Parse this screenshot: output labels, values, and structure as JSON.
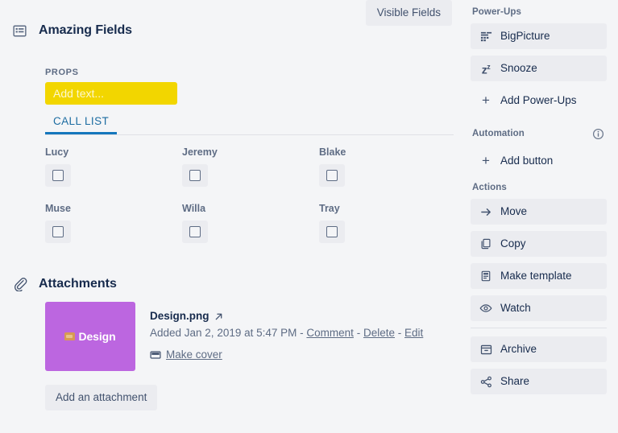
{
  "main": {
    "header": {
      "icon": "list-view-icon",
      "title": "Amazing Fields",
      "visible_fields_label": "Visible Fields"
    },
    "props": {
      "label": "PROPS",
      "placeholder": "Add text...",
      "value": "",
      "color": "#f2d600"
    },
    "tabs": [
      {
        "label": "CALL LIST",
        "active": true
      }
    ],
    "checkboxes": [
      {
        "name": "Lucy",
        "checked": false
      },
      {
        "name": "Jeremy",
        "checked": false
      },
      {
        "name": "Blake",
        "checked": false
      },
      {
        "name": "Muse",
        "checked": false
      },
      {
        "name": "Willa",
        "checked": false
      },
      {
        "name": "Tray",
        "checked": false
      }
    ],
    "attachments": {
      "icon": "paperclip-icon",
      "title": "Attachments",
      "item": {
        "thumb_label": "Design",
        "thumb_color": "#bc66e0",
        "name": "Design.png",
        "open_icon": "external-link-icon",
        "added_text": "Added Jan 2, 2019 at 5:47 PM",
        "separator": "-",
        "comment_label": "Comment",
        "delete_label": "Delete",
        "edit_label": "Edit",
        "make_cover_label": "Make cover",
        "make_cover_icon": "cover-icon"
      },
      "add_button_label": "Add an attachment"
    }
  },
  "sidebar": {
    "powerups": {
      "heading": "Power-Ups",
      "items": [
        {
          "label": "BigPicture",
          "icon": "bigpicture-grid-icon"
        },
        {
          "label": "Snooze",
          "icon": "snooze-z-icon"
        }
      ],
      "add_label": "Add Power-Ups",
      "add_icon": "plus-icon"
    },
    "automation": {
      "heading": "Automation",
      "info_icon": "info-circle-icon",
      "add_label": "Add button",
      "add_icon": "plus-icon"
    },
    "actions": {
      "heading": "Actions",
      "items": [
        {
          "label": "Move",
          "icon": "arrow-right-icon"
        },
        {
          "label": "Copy",
          "icon": "copy-icon"
        },
        {
          "label": "Make template",
          "icon": "template-icon"
        },
        {
          "label": "Watch",
          "icon": "eye-icon"
        }
      ],
      "items2": [
        {
          "label": "Archive",
          "icon": "archive-icon"
        },
        {
          "label": "Share",
          "icon": "share-icon"
        }
      ]
    }
  },
  "colors": {
    "background": "#f4f5f7",
    "button_bg": "#ebecf0",
    "text_primary": "#172b4d",
    "text_muted": "#5e6c84",
    "tab_active": "#1577bd",
    "accent_yellow": "#f2d600",
    "thumb_purple": "#bc66e0"
  }
}
